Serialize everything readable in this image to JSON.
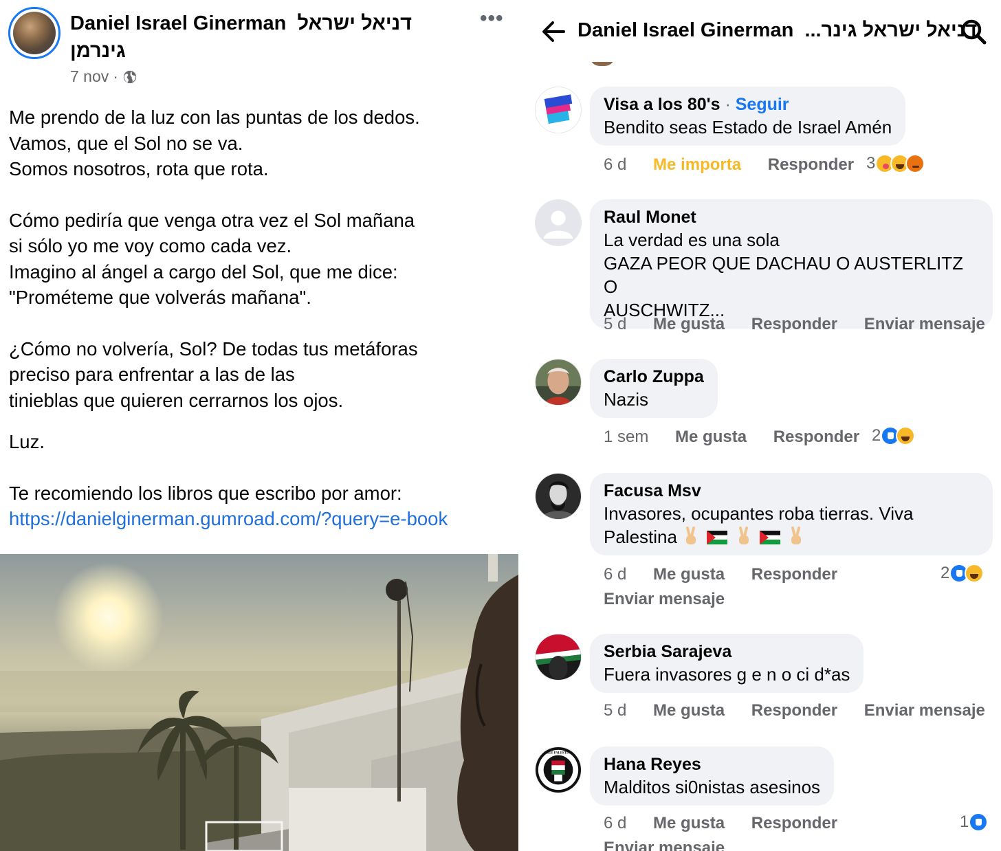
{
  "post": {
    "author": "Daniel Israel Ginerman",
    "author_hebrew": "דניאל ישראל גינרמן",
    "date": "7 nov",
    "meta_sep": "·",
    "more": "•••",
    "paragraphs": [
      "Me prendo de la luz con las puntas de los dedos.\nVamos, que el Sol no se va.\nSomos nosotros, rota que rota.",
      "Cómo pediría que venga otra vez el Sol mañana\nsi sólo yo me voy como cada vez.\nImagino al ángel a cargo del Sol, que me dice:\n\"Prométeme que volverás mañana\".",
      "¿Cómo no volvería, Sol? De todas tus metáforas\npreciso para enfrentar a las de las\ntinieblas que quieren cerrarnos los ojos.",
      "Luz.",
      "Te recomiendo los libros que escribo por amor:"
    ],
    "link": "https://danielginerman.gumroad.com/?query=e-book"
  },
  "header": {
    "title": "Daniel Israel Ginerman",
    "title_hebrew_truncated": "דניאל ישראל גינר...",
    "back_icon": "arrow-left-icon",
    "search_icon": "search-icon"
  },
  "comments": [
    {
      "name": "Visa a los 80's",
      "follow": "Seguir",
      "text": "Bendito seas Estado de Israel Amén",
      "time": "6 d",
      "like": "Me importa",
      "reply": "Responder",
      "reaction_count": "3",
      "reactions": [
        "care",
        "haha",
        "angry"
      ]
    },
    {
      "name": "Raul Monet",
      "text": "La verdad es una sola\nGAZA PEOR QUE DACHAU O AUSTERLITZ O\nAUSCHWITZ...",
      "time": "5 d",
      "like": "Me gusta",
      "reply": "Responder",
      "message": "Enviar mensaje"
    },
    {
      "name": "Carlo Zuppa",
      "text": "Nazis",
      "time": "1 sem",
      "like": "Me gusta",
      "reply": "Responder",
      "reaction_count": "2",
      "reactions": [
        "like",
        "haha"
      ]
    },
    {
      "name": "Facusa Msv",
      "text_line1": "Invasores,  ocupantes roba tierras. Viva",
      "text_line2": "Palestina",
      "time": "6 d",
      "like": "Me gusta",
      "reply": "Responder",
      "message": "Enviar mensaje",
      "reaction_count": "2",
      "reactions": [
        "like",
        "haha"
      ]
    },
    {
      "name": "Serbia Sarajeva",
      "text": "Fuera invasores g e n o ci d*as",
      "time": "5 d",
      "like": "Me gusta",
      "reply": "Responder",
      "message": "Enviar mensaje"
    },
    {
      "name": "Hana Reyes",
      "text": "Malditos si0nistas asesinos",
      "time": "6 d",
      "like": "Me gusta",
      "reply": "Responder",
      "message": "Enviar mensaje",
      "reaction_count": "1",
      "reactions": [
        "like"
      ],
      "avatar_text": "FREE PALESTINE"
    }
  ],
  "colors": {
    "link": "#216fdb",
    "accent": "#1877f2",
    "care_label": "#f7b928",
    "bubble": "#f0f2f5",
    "muted": "#65676b"
  }
}
